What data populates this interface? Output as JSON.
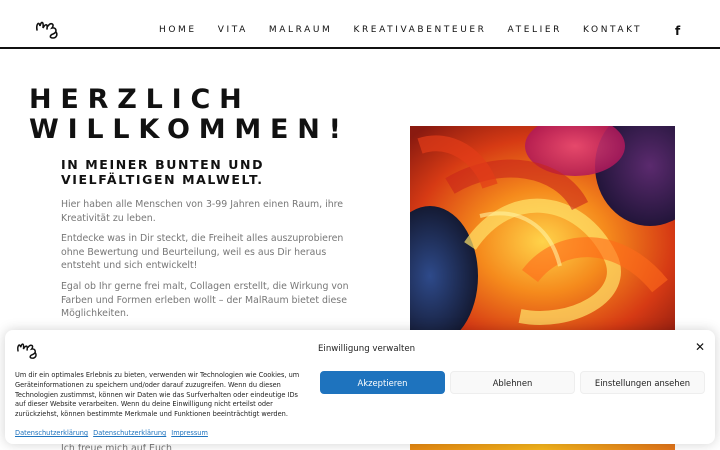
{
  "header": {
    "nav": [
      "HOME",
      "VITA",
      "MALRAUM",
      "KREATIVABENTEUER",
      "ATELIER",
      "KONTAKT"
    ],
    "social_icon": "facebook-icon",
    "social_glyph": "f"
  },
  "main": {
    "welcome_line1": "HERZLICH",
    "welcome_line2": "WILLKOMMEN!",
    "subhead_line1": "IN MEINER BUNTEN UND",
    "subhead_line2": "VIELFÄLTIGEN MALWELT.",
    "p1": "Hier haben alle Menschen von 3-99 Jahren einen Raum, ihre Kreativität zu leben.",
    "p2": "Entdecke was in Dir steckt, die Freiheit alles auszuprobieren ohne Bewertung und Beurteilung, weil es aus Dir heraus entsteht und sich entwickelt!",
    "p3": "Egal ob Ihr gerne frei malt, Collagen erstellt, die Wirkung von Farben und Formen erleben wollt – der MalRaum bietet diese Möglichkeiten.",
    "p5": "Ich freue mich auf Euch"
  },
  "cookie": {
    "title": "Einwilligung verwalten",
    "close_glyph": "✕",
    "text": "Um dir ein optimales Erlebnis zu bieten, verwenden wir Technologien wie Cookies, um Geräteinformationen zu speichern und/oder darauf zuzugreifen. Wenn du diesen Technologien zustimmst, können wir Daten wie das Surfverhalten oder eindeutige IDs auf dieser Website verarbeiten. Wenn du deine Einwilligung nicht erteilst oder zurückziehst, können bestimmte Merkmale und Funktionen beeinträchtigt werden.",
    "accept": "Akzeptieren",
    "deny": "Ablehnen",
    "settings": "Einstellungen ansehen",
    "links": [
      "Datenschutzerklärung",
      "Datenschutzerklärung",
      "Impressum"
    ]
  },
  "colors": {
    "accent": "#1e73be",
    "text": "#111111",
    "muted": "#777777"
  }
}
